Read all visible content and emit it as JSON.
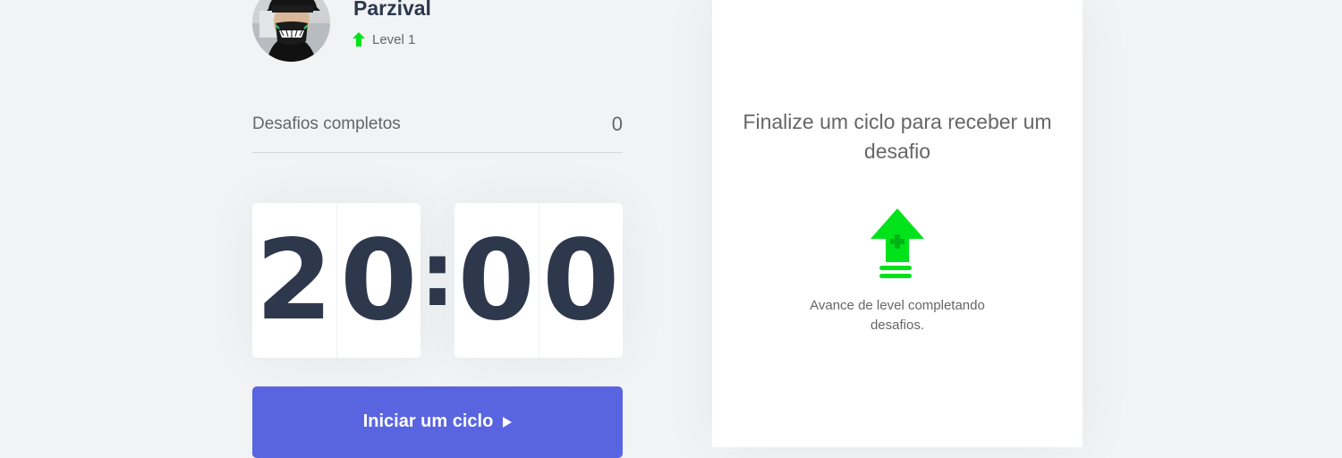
{
  "profile": {
    "username": "Parzival",
    "level_label": "Level 1",
    "avatar_icon": "user-avatar",
    "level_icon": "level-up-arrow-icon"
  },
  "stats": {
    "completed_label": "Desafios completos",
    "completed_value": "0"
  },
  "countdown": {
    "minute_left": "2",
    "minute_right": "0",
    "separator": ":",
    "second_left": "0",
    "second_right": "0"
  },
  "start_button": {
    "label": "Iniciar um ciclo",
    "icon": "play-icon",
    "color": "#5965e0"
  },
  "challenge_box": {
    "title": "Finalize um ciclo para receber um desafio",
    "hint": "Avance de level completando desafios.",
    "icon": "level-up-icon"
  },
  "colors": {
    "accent_green": "#00e31b",
    "text_dark": "#2e384d",
    "text_body": "#666666",
    "background": "#f2f3f5"
  }
}
